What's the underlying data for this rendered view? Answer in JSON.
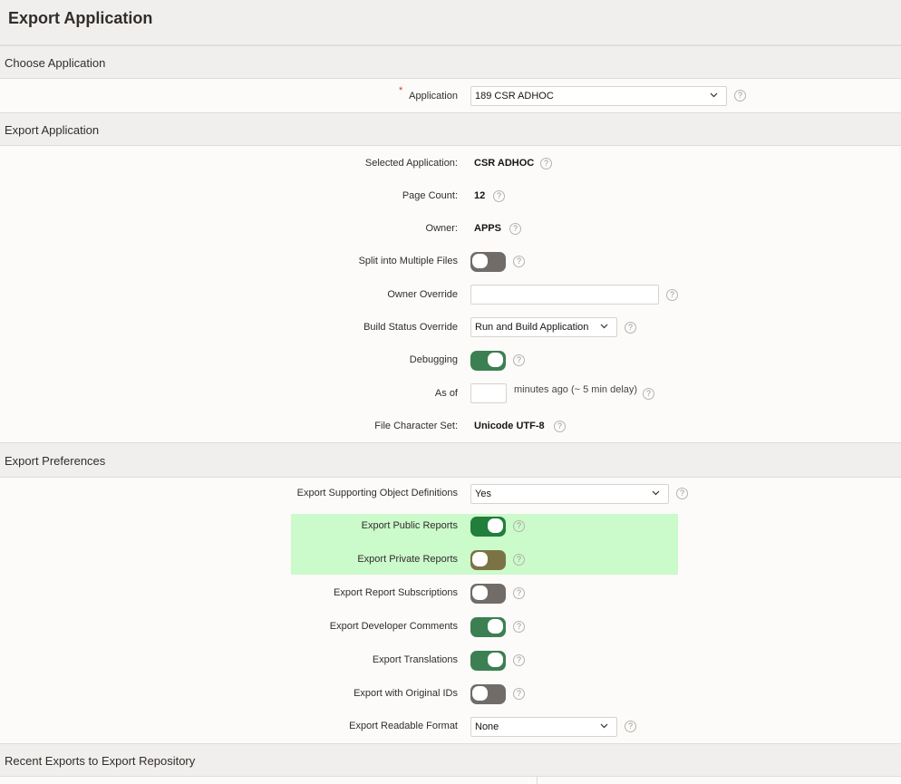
{
  "page": {
    "title": "Export Application"
  },
  "regions": {
    "choose": {
      "title": "Choose Application"
    },
    "export": {
      "title": "Export Application"
    },
    "prefs": {
      "title": "Export Preferences"
    },
    "recent": {
      "title": "Recent Exports to Export Repository"
    }
  },
  "choose": {
    "application_label": "Application",
    "required_mark": "*",
    "application_value": "189 CSR ADHOC"
  },
  "export": {
    "selected_app_label": "Selected Application:",
    "selected_app_value": "CSR ADHOC",
    "page_count_label": "Page Count:",
    "page_count_value": "12",
    "owner_label": "Owner:",
    "owner_value": "APPS",
    "split_label": "Split into Multiple Files",
    "split_on": false,
    "owner_override_label": "Owner Override",
    "owner_override_value": "",
    "build_status_label": "Build Status Override",
    "build_status_value": "Run and Build Application",
    "debugging_label": "Debugging",
    "debugging_on": true,
    "as_of_label": "As of",
    "as_of_value": "",
    "as_of_suffix": "minutes ago (~ 5 min delay)",
    "charset_label": "File Character Set:",
    "charset_value": "Unicode UTF-8"
  },
  "prefs": {
    "supporting_label": "Export Supporting Object Definitions",
    "supporting_value": "Yes",
    "public_reports_label": "Export Public Reports",
    "public_reports_on": true,
    "private_reports_label": "Export Private Reports",
    "private_reports_on": false,
    "subscriptions_label": "Export Report Subscriptions",
    "subscriptions_on": false,
    "dev_comments_label": "Export Developer Comments",
    "dev_comments_on": true,
    "translations_label": "Export Translations",
    "translations_on": true,
    "original_ids_label": "Export with Original IDs",
    "original_ids_on": false,
    "readable_label": "Export Readable Format",
    "readable_value": "None"
  },
  "help_glyph": "?",
  "colors": {
    "toggle_on": "#3c7f52",
    "toggle_off": "#716c68",
    "highlight": "#cbfacb",
    "required": "#d23d2c"
  }
}
